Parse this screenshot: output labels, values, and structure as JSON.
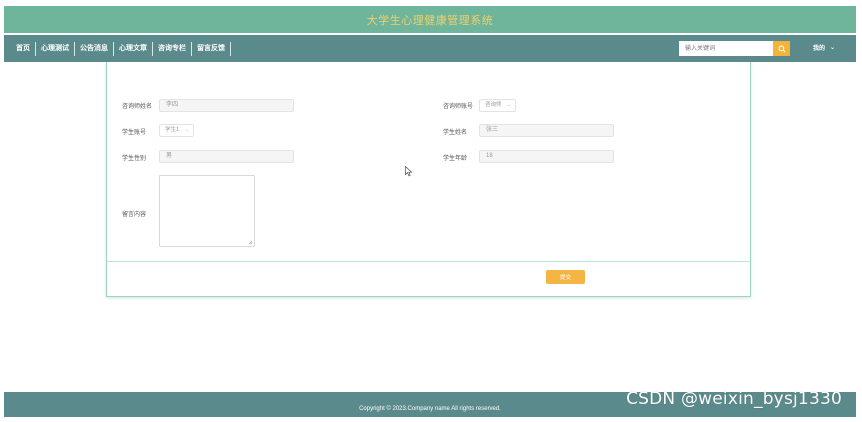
{
  "header": {
    "title": "大学生心理健康管理系统"
  },
  "nav": {
    "items": [
      {
        "id": "home",
        "label": "首页"
      },
      {
        "id": "psych-test",
        "label": "心理测试"
      },
      {
        "id": "announcements",
        "label": "公告消息"
      },
      {
        "id": "psych-articles",
        "label": "心理文章"
      },
      {
        "id": "consult-column",
        "label": "咨询专栏"
      },
      {
        "id": "feedback",
        "label": "留言反馈"
      }
    ],
    "search": {
      "placeholder": "输入关键词",
      "icon": "search-icon"
    },
    "user_menu": {
      "label": "我的",
      "icon": "chevron-down-icon"
    }
  },
  "form": {
    "counselor_name": {
      "label": "咨询师姓名",
      "value": "李四"
    },
    "counselor_account": {
      "label": "咨询师账号",
      "value": "咨询师"
    },
    "student_account": {
      "label": "学生账号",
      "value": "学生1"
    },
    "student_name": {
      "label": "学生姓名",
      "value": "张三"
    },
    "student_gender": {
      "label": "学生性别",
      "value": "男"
    },
    "student_age": {
      "label": "学生年龄",
      "value": "18"
    },
    "message": {
      "label": "留言内容",
      "value": ""
    },
    "submit_label": "提交"
  },
  "footer": {
    "copyright": "Copyright © 2023.Company name All rights reserved.",
    "watermark": "CSDN @weixin_bysj1330"
  },
  "colors": {
    "title_bar": "#6fb59b",
    "title_text": "#f2d06b",
    "nav_bar": "#5b8a8c",
    "accent": "#f5b544",
    "card_border": "#9fd3c6"
  }
}
